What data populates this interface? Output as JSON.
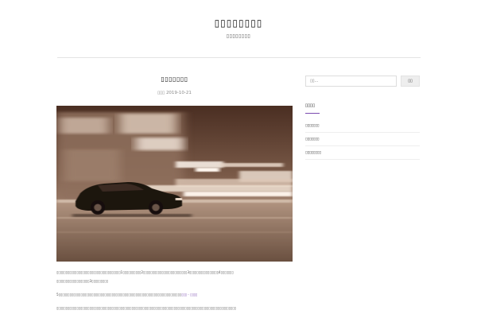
{
  "site": {
    "title": "▯▯▯▯▯▯▯▯",
    "tagline": "▯▯▯▯▯▯▯▯"
  },
  "post": {
    "title": "▯▯▯▯▯▯▯",
    "meta_prefix": "▯▯▯",
    "date": "2019-10-21",
    "image_description": "motion-blurred car at night",
    "paragraphs": {
      "p1_line1": "▯▯▯▯▯▯▯▯▯▯▯▯▯▯▯▯▯▯▯▯▯▯▯▯▯▯▯▯▯▯▯▯▯▯▯1▯▯▯▯▯▯▯▯▯▯2▯▯▯▯▯▯▯▯▯▯▯▯▯▯▯▯▯▯▯▯▯▯▯▯3▯▯▯▯▯▯▯▯▯▯▯▯▯▯▯▯4▯▯▯▯▯▯▯",
      "p1_line2": "▯▯▯▯▯▯▯▯▯▯▯▯▯▯▯▯▯▯3▯▯▯▯▯▯▯▯▯",
      "p2_text": "5▯▯▯▯▯▯▯▯▯▯▯▯▯▯▯▯▯▯▯▯▯▯▯▯▯▯▯▯▯▯▯▯▯▯▯▯▯▯▯▯▯▯▯▯▯▯▯▯▯▯▯▯▯▯▯▯▯▯▯▯▯▯▯▯▯▯▯",
      "p2_link": "▯▯▯ - ▯▯▯▯",
      "p3_text": "▯▯▯▯▯▯▯▯▯▯▯▯▯▯▯▯▯▯▯▯▯▯▯▯▯▯▯▯▯▯▯▯▯▯▯▯▯▯▯▯▯▯▯▯▯▯▯▯▯▯▯▯▯▯▯▯▯▯▯▯▯▯▯▯▯▯▯▯▯▯▯▯▯▯▯▯▯▯▯▯▯▯▯▯▯▯▯▯▯▯▯▯▯▯▯▯▯▯"
    }
  },
  "sidebar": {
    "search_placeholder": "▯▯...",
    "search_button": "▯▯",
    "widget_title": "▯▯▯▯",
    "recent_posts": [
      "▯▯▯▯▯▯▯",
      "▯▯▯▯▯▯▯",
      "▯▯▯▯▯▯▯▯"
    ]
  },
  "colors": {
    "accent": "#7b4bb0",
    "divider": "#e4e4e4",
    "image_tone": "#6b4c3b"
  }
}
